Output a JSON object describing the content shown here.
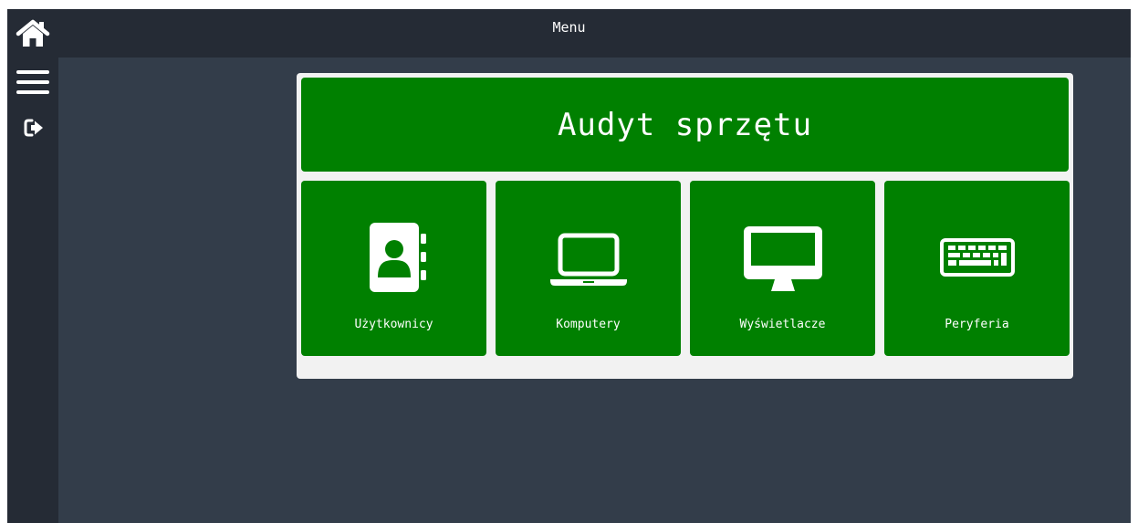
{
  "topbar": {
    "title": "Menu"
  },
  "sidebar": {
    "home_icon": "home-icon",
    "menu_icon": "hamburger-icon",
    "logout_icon": "sign-out-icon"
  },
  "panel": {
    "title": "Audyt sprzętu",
    "tiles": [
      {
        "label": "Użytkownicy",
        "icon": "address-book-icon"
      },
      {
        "label": "Komputery",
        "icon": "laptop-icon"
      },
      {
        "label": "Wyświetlacze",
        "icon": "monitor-icon"
      },
      {
        "label": "Peryferia",
        "icon": "keyboard-icon"
      }
    ]
  },
  "colors": {
    "tile_green": "#008000",
    "bar_dark": "#252b35",
    "background": "#333d4a",
    "panel_bg": "#f2f2f2"
  }
}
